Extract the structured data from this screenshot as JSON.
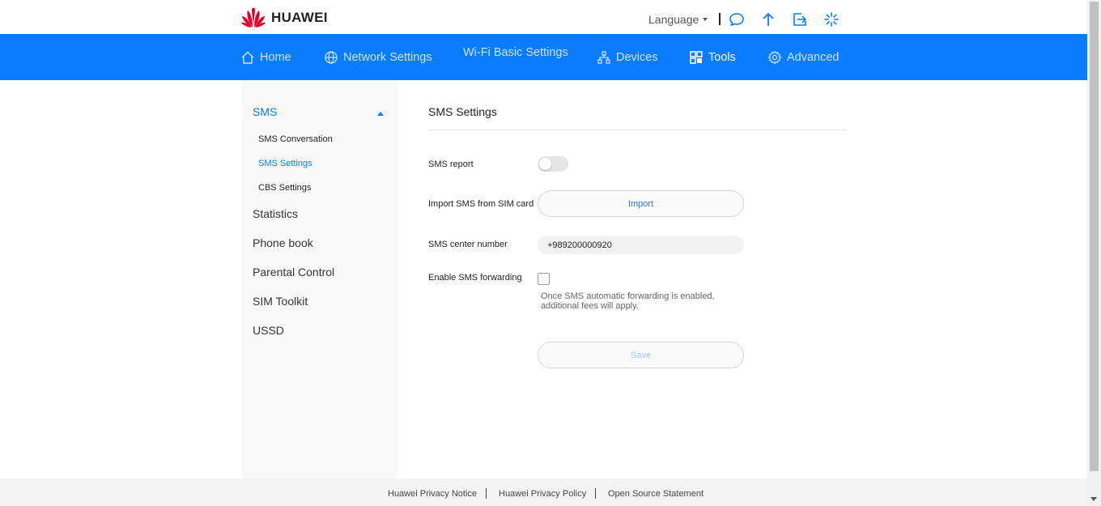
{
  "header": {
    "brand": "HUAWEI",
    "language_label": "Language",
    "icons": [
      "message-icon",
      "upload-icon",
      "logout-icon",
      "loading-spinner-icon"
    ]
  },
  "nav": {
    "items": [
      {
        "label": "Home",
        "icon": "home-icon"
      },
      {
        "label": "Network Settings",
        "icon": "globe-icon"
      },
      {
        "label": "Wi-Fi Basic Settings",
        "icon": "wifi-icon"
      },
      {
        "label": "Devices",
        "icon": "devices-icon"
      },
      {
        "label": "Tools",
        "icon": "tools-icon",
        "active": true
      },
      {
        "label": "Advanced",
        "icon": "gear-icon"
      }
    ]
  },
  "sidebar": {
    "groups": [
      {
        "label": "SMS",
        "open": true
      },
      {
        "label": "Statistics"
      },
      {
        "label": "Phone book"
      },
      {
        "label": "Parental Control"
      },
      {
        "label": "SIM Toolkit"
      },
      {
        "label": "USSD"
      }
    ],
    "sms_sub": [
      {
        "label": "SMS Conversation"
      },
      {
        "label": "SMS Settings",
        "active": true
      },
      {
        "label": "CBS Settings"
      }
    ]
  },
  "main": {
    "title": "SMS Settings",
    "sms_report_label": "SMS report",
    "sms_report_enabled": false,
    "import_label": "Import SMS from SIM card",
    "import_button": "Import",
    "center_number_label": "SMS center number",
    "center_number_value": "+989200000920",
    "forwarding_label": "Enable SMS forwarding",
    "forwarding_enabled": false,
    "forwarding_note": "Once SMS automatic forwarding is enabled, additional fees will apply.",
    "save_button": "Save"
  },
  "footer": {
    "links": [
      "Huawei Privacy Notice",
      "Huawei Privacy Policy",
      "Open Source Statement"
    ]
  },
  "colors": {
    "accent": "#0a7cff",
    "brand_red": "#e4002b"
  }
}
